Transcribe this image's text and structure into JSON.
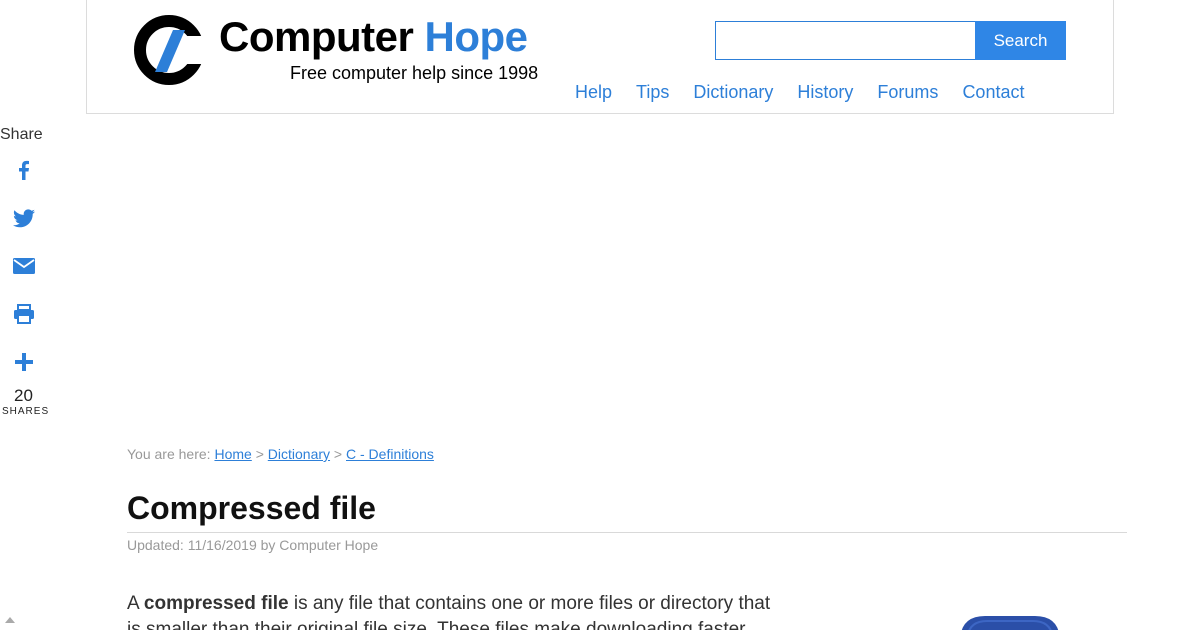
{
  "header": {
    "brand": {
      "name_part1": "Computer",
      "name_part2": "Hope",
      "tagline": "Free computer help since 1998"
    },
    "search": {
      "value": "",
      "placeholder": "",
      "button_label": "Search"
    },
    "nav": [
      {
        "label": "Help"
      },
      {
        "label": "Tips"
      },
      {
        "label": "Dictionary"
      },
      {
        "label": "History"
      },
      {
        "label": "Forums"
      },
      {
        "label": "Contact"
      }
    ]
  },
  "share": {
    "label": "Share",
    "count": "20",
    "count_label": "SHARES",
    "icons": [
      "facebook-icon",
      "twitter-icon",
      "email-icon",
      "print-icon",
      "plus-icon"
    ]
  },
  "breadcrumb": {
    "prefix": "You are here:",
    "items": [
      {
        "label": "Home"
      },
      {
        "label": "Dictionary"
      },
      {
        "label": "C - Definitions"
      }
    ],
    "separator": ">"
  },
  "article": {
    "title": "Compressed file",
    "updated": "Updated: 11/16/2019 by Computer Hope",
    "intro_before": "A ",
    "intro_bold": "compressed file",
    "intro_after": " is any file that contains one or more files or directory that is smaller than their original file size. These files make downloading faster"
  },
  "colors": {
    "accent": "#2d7fd8",
    "button": "#2f86e6",
    "muted": "#999999"
  }
}
